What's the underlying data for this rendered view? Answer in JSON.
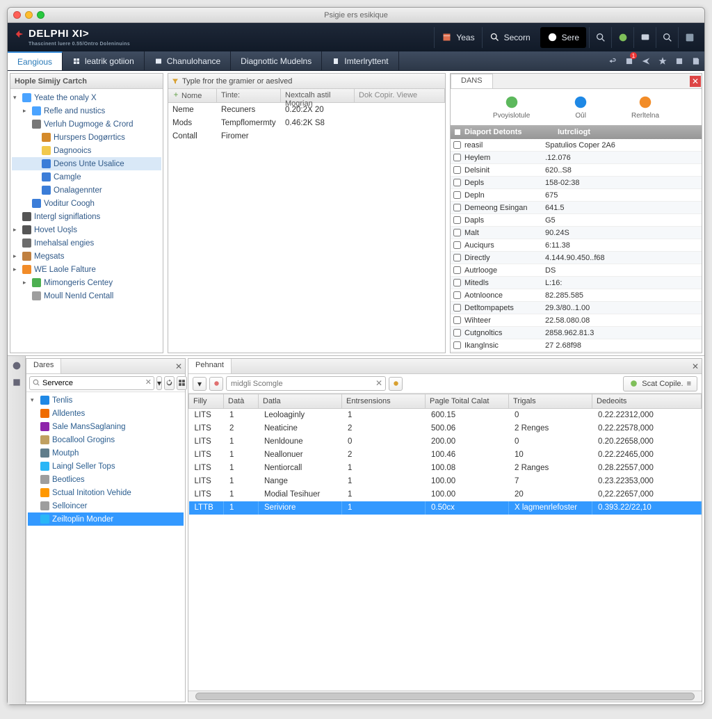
{
  "window_title": "Psigie ers esikique",
  "header": {
    "brand": "DELPHI XI>",
    "brand_sub": "Thascinent luere 0.55/Ontro Doleninuins",
    "year_btn": "Yeas",
    "secorn_btn": "Secorn",
    "sere_btn": "Sere"
  },
  "menubar": {
    "tabs": [
      "Eangious",
      "leatrik gotiion",
      "Chanulohance",
      "Diagnottic Mudelns",
      "Imterlryttent"
    ],
    "notif_badge": "1"
  },
  "left_panel": {
    "title": "Hople Simijy Cartch",
    "tree": [
      {
        "lvl": 0,
        "arrow": "▾",
        "icon": "#4aa3ff",
        "label": "Yeate the onaly X"
      },
      {
        "lvl": 1,
        "arrow": "▸",
        "icon": "#4aa3ff",
        "label": "Refle and nustics"
      },
      {
        "lvl": 1,
        "arrow": "",
        "icon": "#777",
        "label": "Verluh Dugmoge & Crord"
      },
      {
        "lvl": 2,
        "arrow": "",
        "icon": "#d58a2a",
        "label": "Hurspers Dogørrtics"
      },
      {
        "lvl": 2,
        "arrow": "",
        "icon": "#f2c94c",
        "label": "Dagnooics"
      },
      {
        "lvl": 2,
        "arrow": "",
        "icon": "#3b7dd8",
        "label": "Deons Unte Usalice",
        "selected": true
      },
      {
        "lvl": 2,
        "arrow": "",
        "icon": "#3b7dd8",
        "label": "Camgle"
      },
      {
        "lvl": 2,
        "arrow": "",
        "icon": "#3b7dd8",
        "label": "Onalagennter"
      },
      {
        "lvl": 1,
        "arrow": "",
        "icon": "#3b7dd8",
        "label": "Voditur Coogh"
      },
      {
        "lvl": 0,
        "arrow": "",
        "icon": "#555",
        "label": "Intergl signiflations"
      },
      {
        "lvl": 0,
        "arrow": "▸",
        "icon": "#555",
        "label": "Hovet Uoşls"
      },
      {
        "lvl": 0,
        "arrow": "",
        "icon": "#6c6c6c",
        "label": "Imehalsal engies"
      },
      {
        "lvl": 0,
        "arrow": "▸",
        "icon": "#c08040",
        "label": "Megsats"
      },
      {
        "lvl": 0,
        "arrow": "▸",
        "icon": "#f28c28",
        "label": "WE Laole Falture"
      },
      {
        "lvl": 1,
        "arrow": "▸",
        "icon": "#4caf50",
        "label": "Mimongeris Centey"
      },
      {
        "lvl": 1,
        "arrow": "",
        "icon": "#9e9e9e",
        "label": "Moull NenId Centall"
      }
    ]
  },
  "mid_panel": {
    "header": "Typle fror the gramier or aeslved",
    "columns": [
      "Nome",
      "Tinte:",
      "Nextcalh astil Mogrian",
      "Dok Copir. Viewe"
    ],
    "rows": [
      {
        "c0": "Neme",
        "c1": "Recuners",
        "c2": "0.20:2X 20"
      },
      {
        "c0": "Mods",
        "c1": "Tempflomermty",
        "c2": "0.46:2K S8"
      },
      {
        "c0": "Contall",
        "c1": "Firomer",
        "c2": ""
      }
    ]
  },
  "right_panel": {
    "tab": "DANS",
    "icons": [
      {
        "label": "Pvoyislotule",
        "color": "#5cb85c"
      },
      {
        "label": "Oûl",
        "color": "#1e88e5"
      },
      {
        "label": "Rerltelna",
        "color": "#f28c28"
      }
    ],
    "props_header": {
      "c0": "Diaport Detonts",
      "c1": "Iutrcliogt"
    },
    "props": [
      {
        "name": "reasil",
        "val": "Spatulios Coper 2A6"
      },
      {
        "name": "Heylem",
        "val": ".12.076"
      },
      {
        "name": "Delsinit",
        "val": "620..S8"
      },
      {
        "name": "Depls",
        "val": "158-02:38"
      },
      {
        "name": "Depln",
        "val": "675"
      },
      {
        "name": "Demeong Esingan",
        "val": "641.5"
      },
      {
        "name": "Dapls",
        "val": "G5"
      },
      {
        "name": "Malt",
        "val": "90.24S"
      },
      {
        "name": "Auciqurs",
        "val": "6:11.38"
      },
      {
        "name": "Directly",
        "val": "4.144.90.450..f68"
      },
      {
        "name": "Autrlooge",
        "val": "DS"
      },
      {
        "name": "Mitedls",
        "val": "L:16:"
      },
      {
        "name": "Aotnloonce",
        "val": "82.285.585"
      },
      {
        "name": "Detltompapets",
        "val": "29.3/80..1.00"
      },
      {
        "name": "Wihteer",
        "val": "22.58.080.08"
      },
      {
        "name": "Cutgnoltics",
        "val": "2858.962.81.3"
      },
      {
        "name": "Ikanglnsic",
        "val": "27 2.68f98"
      }
    ]
  },
  "dares": {
    "tab": "Dares",
    "search_value": "Serverce",
    "tree": [
      {
        "arrow": "▾",
        "icon": "#1e88e5",
        "label": "Tenlis"
      },
      {
        "arrow": "",
        "icon": "#ef6c00",
        "label": "Alldentes"
      },
      {
        "arrow": "",
        "icon": "#8e24aa",
        "label": "Sale MansSaglaning"
      },
      {
        "arrow": "",
        "icon": "#c0a060",
        "label": "Bocallool Grogins"
      },
      {
        "arrow": "",
        "icon": "#607d8b",
        "label": "Moutph"
      },
      {
        "arrow": "",
        "icon": "#29b6f6",
        "label": "Laingl Seller Tops"
      },
      {
        "arrow": "",
        "icon": "#9e9e9e",
        "label": "Beotlices"
      },
      {
        "arrow": "",
        "icon": "#ff9800",
        "label": "Sctual Initotion Vehide"
      },
      {
        "arrow": "",
        "icon": "#9e9e9e",
        "label": "Selloincer"
      },
      {
        "arrow": "",
        "icon": "#29b6f6",
        "label": "Zeiltoplin Monder",
        "selected": true
      }
    ]
  },
  "pehnant": {
    "tab": "Pehnant",
    "search_placeholder": "midgli Scomgle",
    "scat_btn": "Scat Copile.",
    "columns": [
      "Filly",
      "Datà",
      "Datla",
      "Entrsensions",
      "Pagle Toital Calat",
      "Trigals",
      "Dedeoits"
    ],
    "rows": [
      {
        "c0": "LITS",
        "c1": "1",
        "c2": "Leoloaginly",
        "c3": "1",
        "c4": "600.15",
        "c5": "0",
        "c6": "0.22.22312,000"
      },
      {
        "c0": "LITS",
        "c1": "2",
        "c2": "Neaticine",
        "c3": "2",
        "c4": "500.06",
        "c5": "2 Renges",
        "c6": "0.22.22578,000"
      },
      {
        "c0": "LITS",
        "c1": "1",
        "c2": "Nenldoune",
        "c3": "0",
        "c4": "200.00",
        "c5": "0",
        "c6": "0.20.22658,000"
      },
      {
        "c0": "LITS",
        "c1": "1",
        "c2": "Neallonuer",
        "c3": "2",
        "c4": "100.46",
        "c5": "10",
        "c6": "0.22.22465,000"
      },
      {
        "c0": "LITS",
        "c1": "1",
        "c2": "Nentiorcall",
        "c3": "1",
        "c4": "100.08",
        "c5": "2 Ranges",
        "c6": "0.28.22557,000"
      },
      {
        "c0": "LITS",
        "c1": "1",
        "c2": "Nange",
        "c3": "1",
        "c4": "100.00",
        "c5": "7",
        "c6": "0.23.22353,000"
      },
      {
        "c0": "LITS",
        "c1": "1",
        "c2": "Modial Tesihuer",
        "c3": "1",
        "c4": "100.00",
        "c5": "20",
        "c6": "0,22.22657,000"
      },
      {
        "c0": "LTTB",
        "c1": "1",
        "c2": "Seriviore",
        "c3": "1",
        "c4": "0.50cx",
        "c5": "X lagmenrlefoster",
        "c6": "0.393.22/22,10",
        "sel": true
      }
    ]
  }
}
